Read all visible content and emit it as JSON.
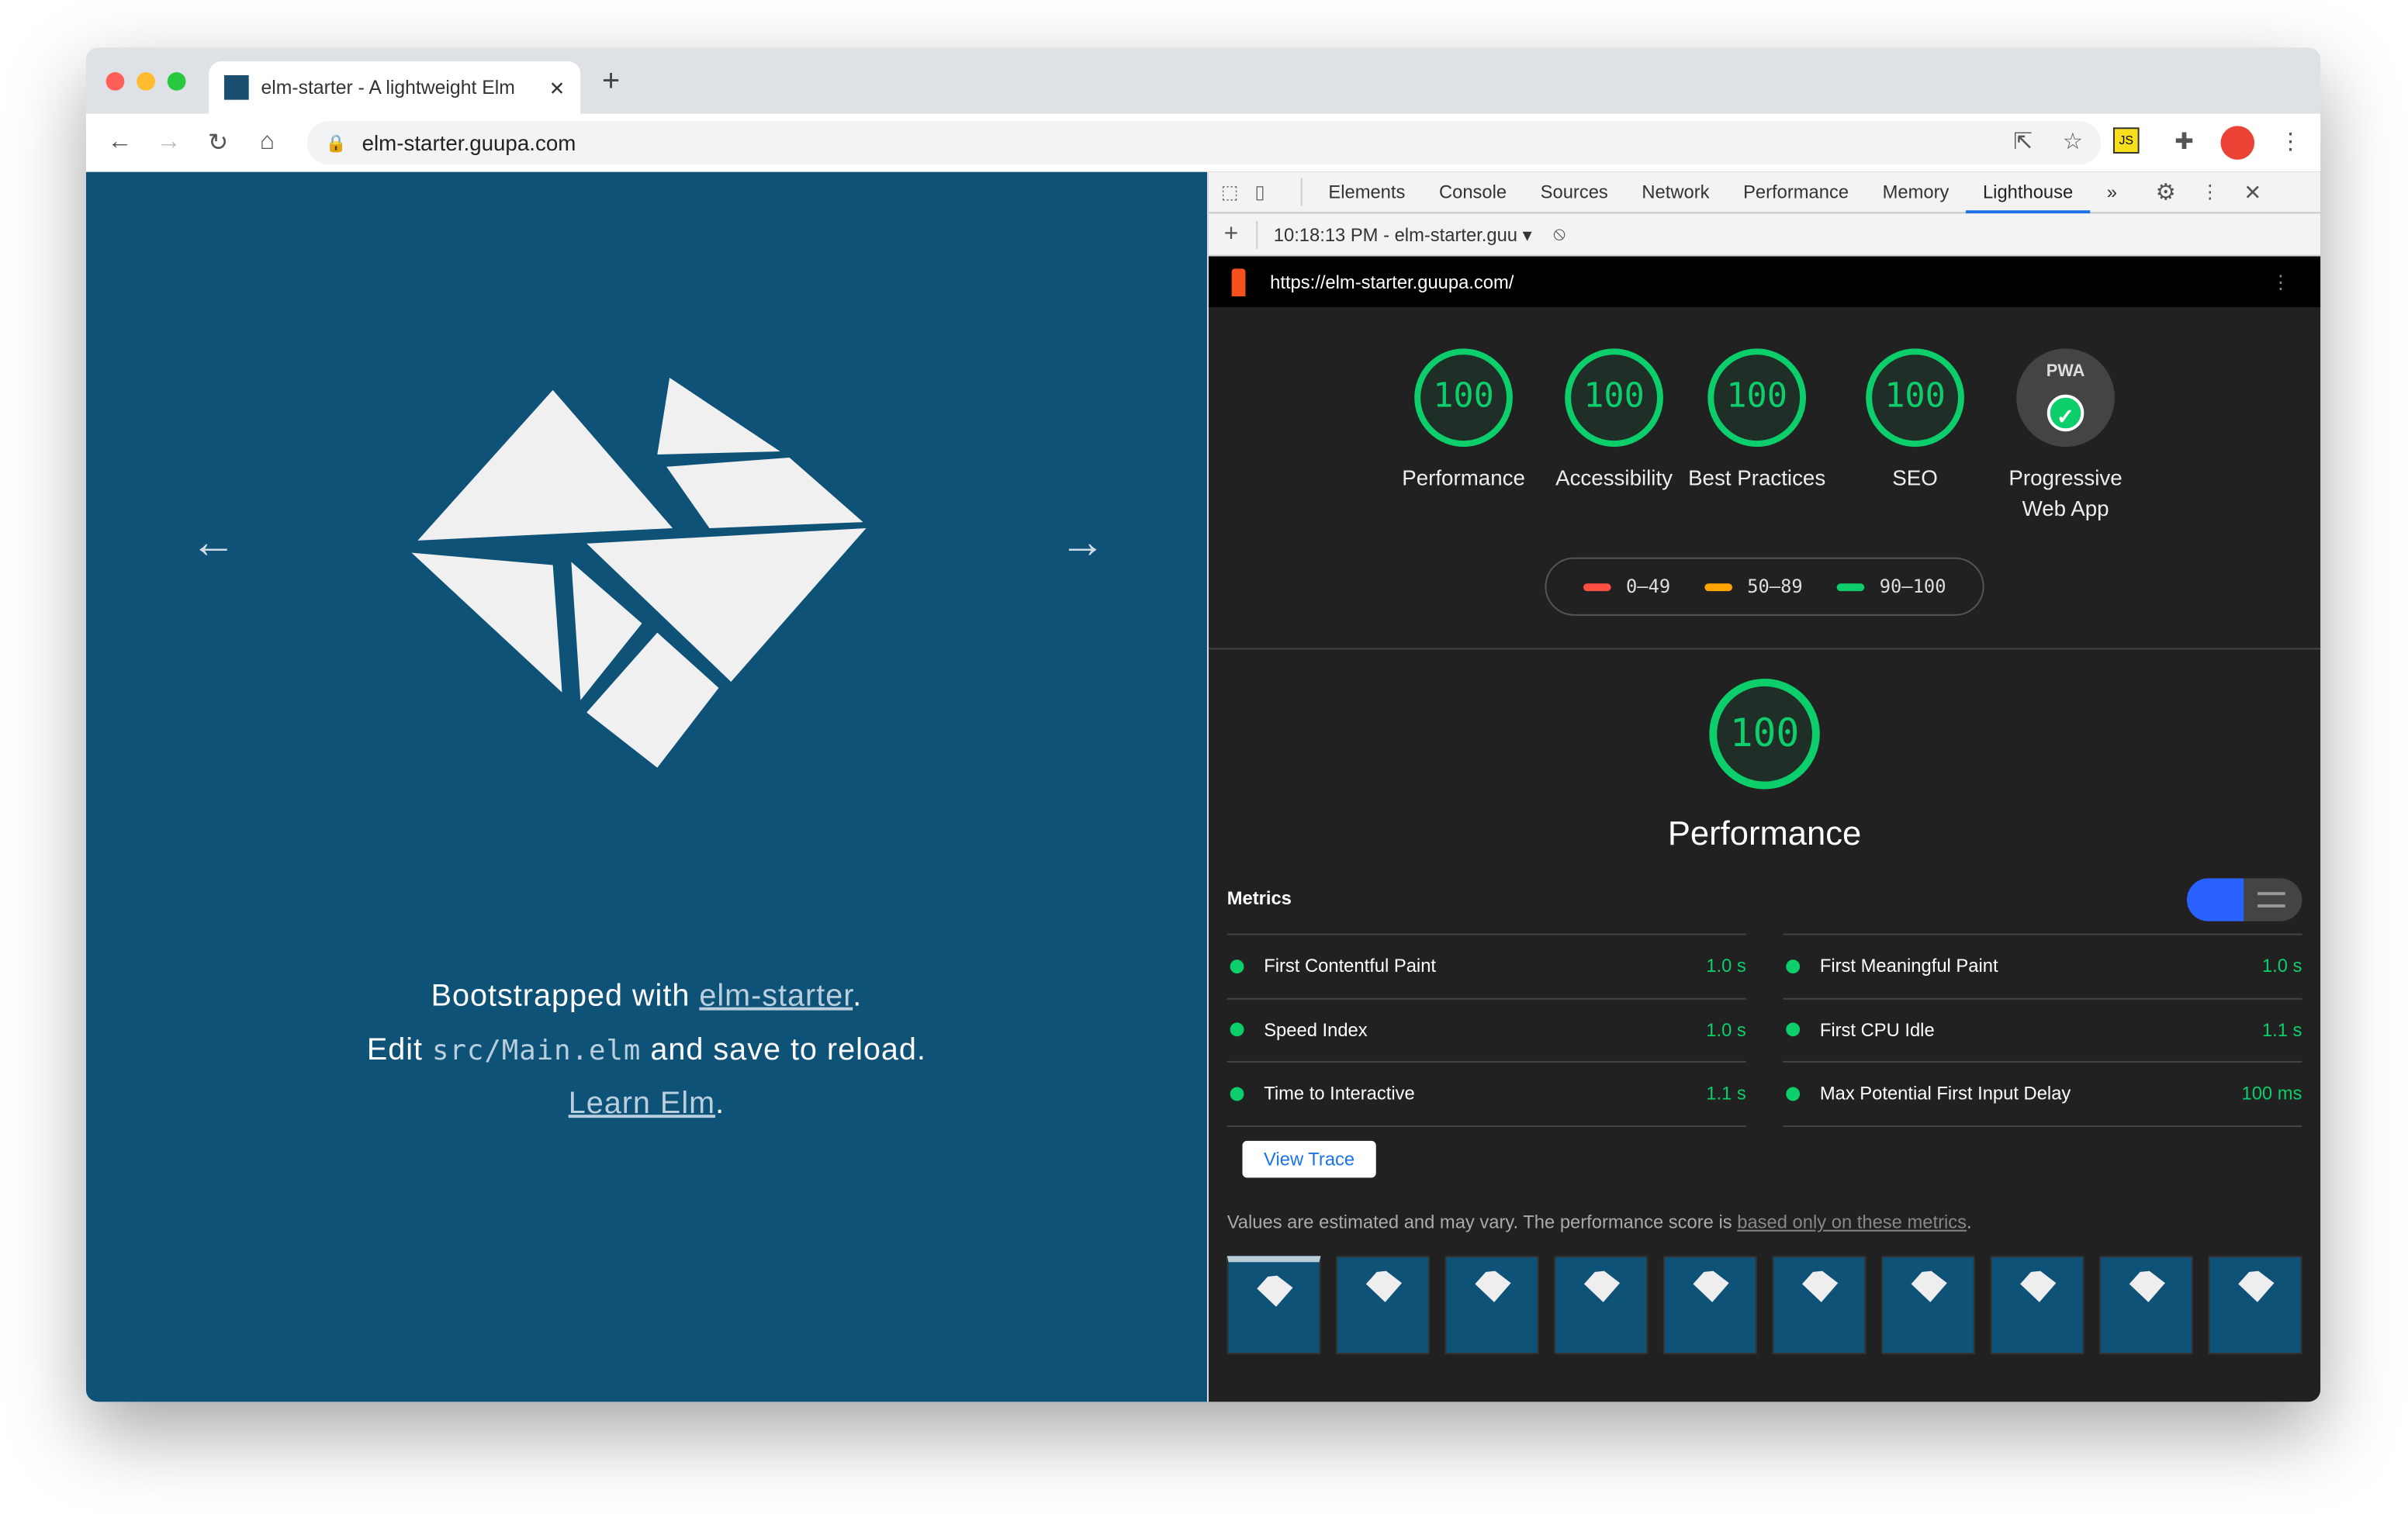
{
  "browser": {
    "tab_title": "elm-starter - A lightweight Elm",
    "url": "elm-starter.guupa.com"
  },
  "page": {
    "line1_prefix": "Bootstrapped with ",
    "line1_link": "elm-starter",
    "line2_prefix": "Edit ",
    "line2_code": "src/Main.elm",
    "line2_suffix": " and save to reload.",
    "line3_link": "Learn Elm",
    "prev": "←",
    "next": "→",
    "period": "."
  },
  "devtools": {
    "tabs": [
      "Elements",
      "Console",
      "Sources",
      "Network",
      "Performance",
      "Memory",
      "Lighthouse"
    ],
    "active_tab": "Lighthouse",
    "more": "»",
    "report_select": "10:18:13 PM - elm-starter.guu",
    "report_url": "https://elm-starter.guupa.com/"
  },
  "lighthouse": {
    "gauges": [
      {
        "score": "100",
        "label": "Performance"
      },
      {
        "score": "100",
        "label": "Accessibility"
      },
      {
        "score": "100",
        "label": "Best Practices"
      },
      {
        "score": "100",
        "label": "SEO"
      },
      {
        "score": "PWA",
        "label": "Progressive Web App"
      }
    ],
    "legend": [
      {
        "range": "0–49",
        "color": "#ff4e42"
      },
      {
        "range": "50–89",
        "color": "#ffa400"
      },
      {
        "range": "90–100",
        "color": "#0cce6b"
      }
    ],
    "category": {
      "score": "100",
      "title": "Performance"
    },
    "metrics_heading": "Metrics",
    "metrics_left": [
      {
        "name": "First Contentful Paint",
        "value": "1.0 s"
      },
      {
        "name": "Speed Index",
        "value": "1.0 s"
      },
      {
        "name": "Time to Interactive",
        "value": "1.1 s"
      }
    ],
    "metrics_right": [
      {
        "name": "First Meaningful Paint",
        "value": "1.0 s"
      },
      {
        "name": "First CPU Idle",
        "value": "1.1 s"
      },
      {
        "name": "Max Potential First Input Delay",
        "value": "100 ms"
      }
    ],
    "view_trace": "View Trace",
    "note_prefix": "Values are estimated and may vary. The performance score is ",
    "note_link": "based only on these metrics",
    "note_suffix": ".",
    "pass_color": "#0cce6b"
  }
}
